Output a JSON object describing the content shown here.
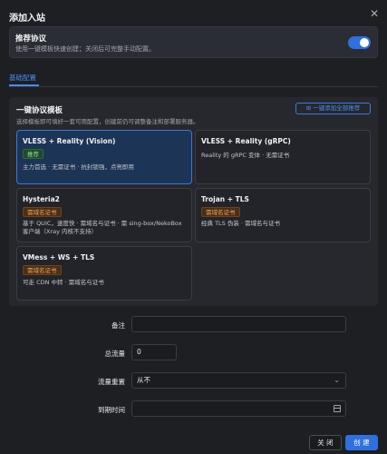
{
  "dialog": {
    "title": "添加入站",
    "close_glyph": "✕"
  },
  "recommend": {
    "title": "推荐协议",
    "subtitle": "使用一键模板快速创建；关闭后可完整手动配置。",
    "toggle_on": true
  },
  "tabs": [
    {
      "label": "基础配置",
      "active": true
    }
  ],
  "templates": {
    "title": "一键协议模板",
    "subtitle": "选择模板即可填好一套可用配置，创建前仍可调整备注和部署服务器。",
    "add_all_label": "⊞ 一键添加全部推荐",
    "cards": [
      {
        "name": "VLESS + Reality (Vision)",
        "badge": "推荐",
        "badge_color": "green",
        "desc": "主力首选 · 无需证书 · 抗封锁强，点亮即用",
        "selected": true
      },
      {
        "name": "VLESS + Reality (gRPC)",
        "badge": "",
        "badge_color": "",
        "desc": "Reality 的 gRPC 变体 · 无需证书",
        "selected": false
      },
      {
        "name": "Hysteria2",
        "badge": "需域名证书",
        "badge_color": "orange",
        "desc": "基于 QUIC，速度快 · 需域名与证书 · 需 sing-box/NekoBox 客户端（Xray 内核不支持）",
        "selected": false
      },
      {
        "name": "Trojan + TLS",
        "badge": "需域名证书",
        "badge_color": "orange",
        "desc": "经典 TLS 伪装 · 需域名与证书",
        "selected": false
      },
      {
        "name": "VMess + WS + TLS",
        "badge": "需域名证书",
        "badge_color": "orange",
        "desc": "可走 CDN 中转 · 需域名与证书",
        "selected": false
      }
    ]
  },
  "form": {
    "remark": {
      "label": "备注",
      "value": ""
    },
    "total_traffic": {
      "label": "总流量",
      "value": "0"
    },
    "traffic_reset": {
      "label": "流量重置",
      "value": "从不"
    },
    "expire_time": {
      "label": "到期时间",
      "value": ""
    }
  },
  "footer": {
    "close_label": "关 闭",
    "create_label": "创 建"
  },
  "colors": {
    "accent": "#2f6fe0",
    "background": "#1d1f23",
    "panel": "#26282d",
    "badge_green": "#8fe08f",
    "badge_orange": "#f0a050"
  }
}
